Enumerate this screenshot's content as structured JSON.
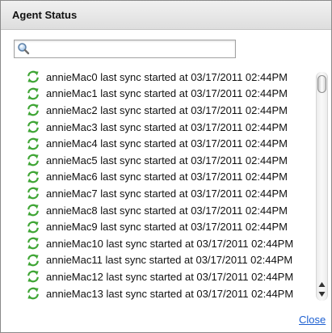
{
  "dialog": {
    "title": "Agent Status",
    "close_label": "Close"
  },
  "search": {
    "value": "",
    "placeholder": "",
    "icon": "search-icon"
  },
  "agents": [
    {
      "label": "annieMac0 last sync started at 03/17/2011 02:44PM",
      "icon": "sync-icon"
    },
    {
      "label": "annieMac1 last sync started at 03/17/2011 02:44PM",
      "icon": "sync-icon"
    },
    {
      "label": "annieMac2 last sync started at 03/17/2011 02:44PM",
      "icon": "sync-icon"
    },
    {
      "label": "annieMac3 last sync started at 03/17/2011 02:44PM",
      "icon": "sync-icon"
    },
    {
      "label": "annieMac4 last sync started at 03/17/2011 02:44PM",
      "icon": "sync-icon"
    },
    {
      "label": "annieMac5 last sync started at 03/17/2011 02:44PM",
      "icon": "sync-icon"
    },
    {
      "label": "annieMac6 last sync started at 03/17/2011 02:44PM",
      "icon": "sync-icon"
    },
    {
      "label": "annieMac7 last sync started at 03/17/2011 02:44PM",
      "icon": "sync-icon"
    },
    {
      "label": "annieMac8 last sync started at 03/17/2011 02:44PM",
      "icon": "sync-icon"
    },
    {
      "label": "annieMac9 last sync started at 03/17/2011 02:44PM",
      "icon": "sync-icon"
    },
    {
      "label": "annieMac10 last sync started at 03/17/2011 02:44PM",
      "icon": "sync-icon"
    },
    {
      "label": "annieMac11 last sync started at 03/17/2011 02:44PM",
      "icon": "sync-icon"
    },
    {
      "label": "annieMac12 last sync started at 03/17/2011 02:44PM",
      "icon": "sync-icon"
    },
    {
      "label": "annieMac13 last sync started at 03/17/2011 02:44PM",
      "icon": "sync-icon"
    }
  ],
  "colors": {
    "sync_green": "#3fa535",
    "link_blue": "#1c5fd1"
  }
}
